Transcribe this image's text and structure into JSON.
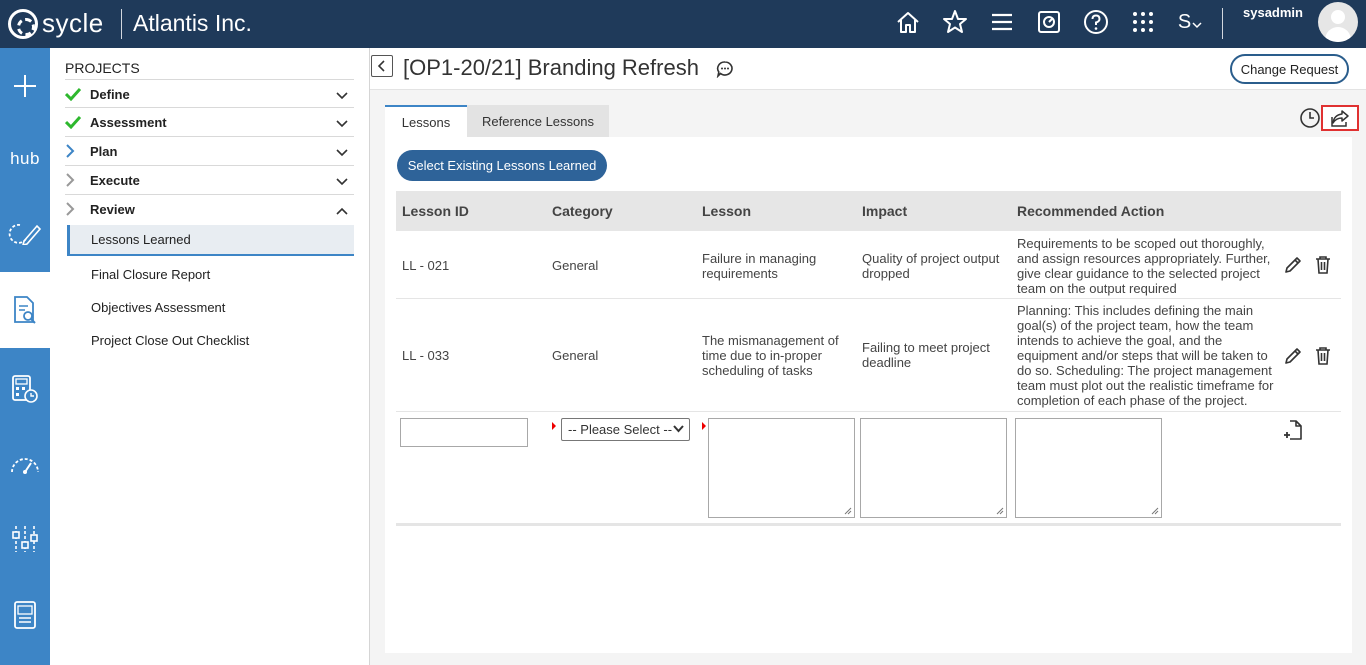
{
  "brand": {
    "logo_text": "sycle",
    "company": "Atlantis Inc."
  },
  "topbar": {
    "icons": [
      "home-icon",
      "star-icon",
      "menu-icon",
      "dashboard-icon",
      "help-icon",
      "apps-grid-icon",
      "language-switch-icon"
    ],
    "lang_label": "S",
    "username": "sysadmin"
  },
  "rail": {
    "items": [
      "add-icon",
      "hub-icon",
      "edit-progress-icon",
      "document-search-icon",
      "calculator-clock-icon",
      "gauge-icon",
      "sliders-icon",
      "report-icon"
    ],
    "hub_label": "hub"
  },
  "nav": {
    "title": "PROJECTS",
    "sections": [
      {
        "label": "Define",
        "status": "complete",
        "expanded": false
      },
      {
        "label": "Assessment",
        "status": "complete",
        "expanded": false
      },
      {
        "label": "Plan",
        "status": "current",
        "expanded": false
      },
      {
        "label": "Execute",
        "status": "pending",
        "expanded": false
      },
      {
        "label": "Review",
        "status": "pending",
        "expanded": true
      }
    ],
    "review_items": [
      "Lessons Learned",
      "Final Closure Report",
      "Objectives Assessment",
      "Project Close Out Checklist"
    ],
    "active_item": "Lessons Learned"
  },
  "page": {
    "title": "[OP1-20/21] Branding Refresh",
    "change_request": "Change Request"
  },
  "tabs": [
    {
      "label": "Lessons",
      "active": true
    },
    {
      "label": "Reference Lessons",
      "active": false
    }
  ],
  "select_existing": "Select Existing Lessons Learned",
  "table": {
    "headers": [
      "Lesson ID",
      "Category",
      "Lesson",
      "Impact",
      "Recommended Action"
    ],
    "rows": [
      {
        "id": "LL - 021",
        "category": "General",
        "lesson": "Failure in managing requirements",
        "impact": "Quality of project output dropped",
        "action": "Requirements to be scoped out thoroughly, and assign resources appropriately. Further, give clear guidance to the selected project team on the output required"
      },
      {
        "id": "LL - 033",
        "category": "General",
        "lesson": "The mismanagement of time due to in-proper scheduling of tasks",
        "impact": "Failing to meet project deadline",
        "action": "Planning: This includes defining the main goal(s) of the project team, how the team intends to achieve the goal, and the equipment and/or steps that will be taken to do so. Scheduling: The project management team must plot out the realistic timeframe for completion of each phase of the project."
      }
    ],
    "new_row": {
      "id_value": "",
      "category_placeholder": "-- Please Select --",
      "lesson_value": "",
      "impact_value": "",
      "action_value": ""
    }
  },
  "colors": {
    "topbar": "#1f3a5a",
    "rail": "#3d85c6",
    "primary_button": "#2e6399",
    "highlight_box": "#e03131",
    "check": "#2eb82e"
  }
}
